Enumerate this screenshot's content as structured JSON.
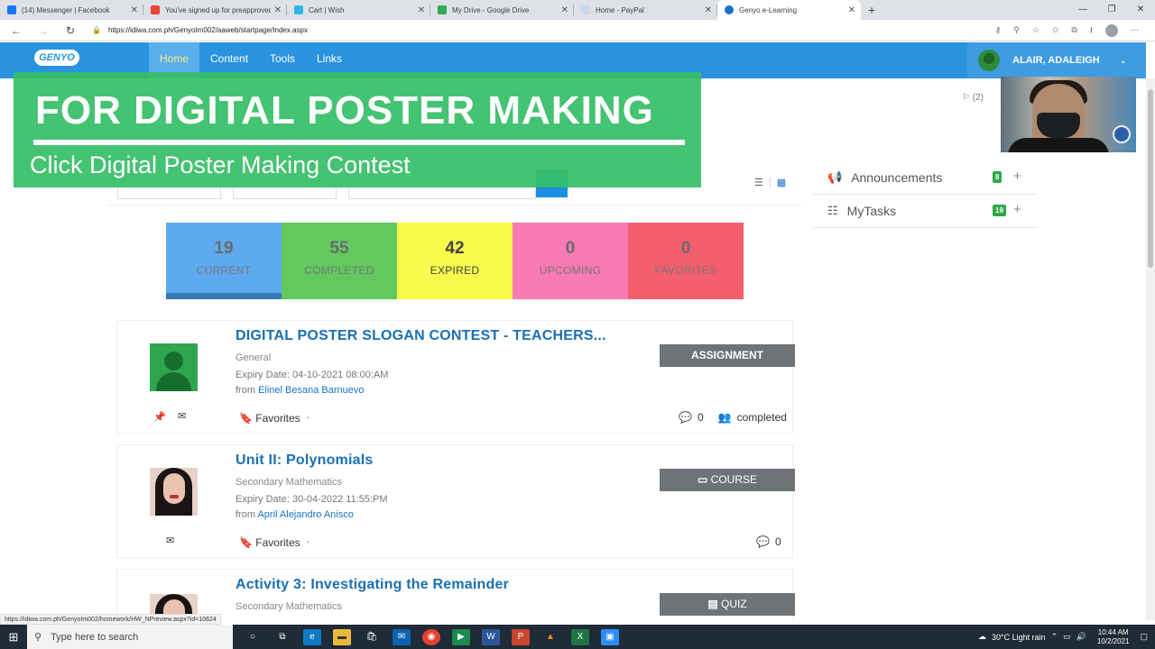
{
  "browser": {
    "tabs": [
      {
        "label": "(14) Messenger | Facebook",
        "color": "#1877f2"
      },
      {
        "label": "You've signed up for preapproved...",
        "color": "#ea4335"
      },
      {
        "label": "Cart | Wish",
        "color": "#2fb7ec"
      },
      {
        "label": "My Drive - Google Drive",
        "color": "#34a853"
      },
      {
        "label": "Home - PayPal",
        "color": "#c9d8ea"
      },
      {
        "label": "Genyo e-Learning",
        "color": "#1a73c9"
      }
    ],
    "url": "https://idiwa.com.ph/GenyoIm002/aaweb/startpage/Index.aspx",
    "status_url": "https://idiwa.com.ph/GenyoIm002/homework/HW_NPreview.aspx?id=10624"
  },
  "site": {
    "logo": "GENYO",
    "nav": [
      "Home",
      "Content",
      "Tools",
      "Links"
    ],
    "user_name": "ALAIR, ADALEIGH",
    "flag_count": "(2)"
  },
  "overlay": {
    "title": "FOR DIGITAL POSTER MAKING",
    "subtitle": "Click Digital Poster Making Contest"
  },
  "stats": [
    {
      "value": "19",
      "label": "CURRENT"
    },
    {
      "value": "55",
      "label": "COMPLETED"
    },
    {
      "value": "42",
      "label": "EXPIRED"
    },
    {
      "value": "0",
      "label": "UPCOMING"
    },
    {
      "value": "0",
      "label": "FAVORITES"
    }
  ],
  "sidebar": [
    {
      "label": "Announcements",
      "count": "8"
    },
    {
      "label": "MyTasks",
      "count": "19"
    }
  ],
  "cards": [
    {
      "title": "DIGITAL POSTER SLOGAN CONTEST - TEACHERS...",
      "subject": "General",
      "expiry": "Expiry Date: 04-10-2021 08:00:AM",
      "from_label": "from",
      "author": "Elinel Besana Barnuevo",
      "type": "ASSIGNMENT",
      "favorites": "Favorites",
      "comments": "0",
      "status": "completed"
    },
    {
      "title": "Unit II: Polynomials",
      "subject": "Secondary Mathematics",
      "expiry": "Expiry Date: 30-04-2022 11:55:PM",
      "from_label": "from",
      "author": "April Alejandro Anisco",
      "type": "COURSE",
      "favorites": "Favorites",
      "comments": "0"
    },
    {
      "title": "Activity 3: Investigating the Remainder",
      "subject": "Secondary Mathematics",
      "type": "QUIZ"
    }
  ],
  "taskbar": {
    "search_placeholder": "Type here to search",
    "weather": "30°C  Light rain",
    "time": "10:44 AM",
    "date": "10/2/2021"
  }
}
